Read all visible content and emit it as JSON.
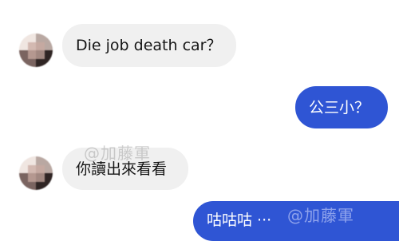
{
  "messages": [
    {
      "side": "in",
      "text": "Die job death car？"
    },
    {
      "side": "out",
      "text": "公三小？"
    },
    {
      "side": "in",
      "text": "你讀出來看看"
    },
    {
      "side": "out",
      "text": "咕咕咕 ···"
    }
  ],
  "watermarks": [
    "@加藤軍",
    "@加藤軍"
  ],
  "colors": {
    "incoming_bubble": "#f0f0f0",
    "outgoing_bubble": "#2f55d4"
  }
}
